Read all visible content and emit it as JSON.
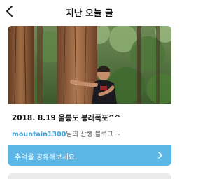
{
  "header": {
    "title": "지난 오늘 글"
  },
  "post": {
    "title": "2018. 8.19 울릉도 봉래폭포^^",
    "blogger": "mountain1300",
    "blog_suffix": "님의 산행 블로그 ~"
  },
  "share": {
    "label": "추억을 공유해보세요."
  },
  "colors": {
    "accent": "#5cb6e6",
    "blogger_text": "#3fa1d8"
  },
  "icons": {
    "back": "chevron-left-icon",
    "share_arrow": "chevron-right-icon"
  }
}
